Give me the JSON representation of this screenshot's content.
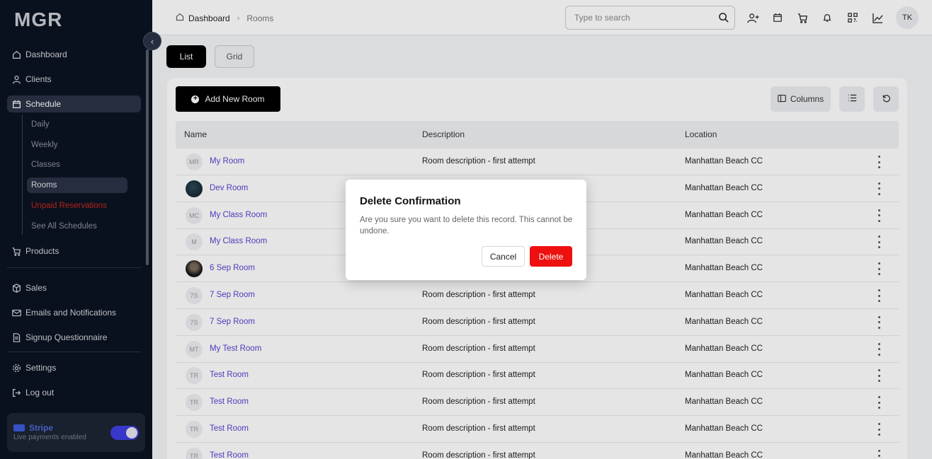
{
  "sidebar": {
    "logo": "MGR",
    "items": [
      {
        "label": "Dashboard",
        "icon": "home-icon"
      },
      {
        "label": "Clients",
        "icon": "user-icon"
      },
      {
        "label": "Schedule",
        "icon": "calendar-icon"
      },
      {
        "label": "Products",
        "icon": "cart-icon"
      },
      {
        "label": "Sales",
        "icon": "box-icon"
      },
      {
        "label": "Emails and Notifications",
        "icon": "mail-icon"
      },
      {
        "label": "Signup Questionnaire",
        "icon": "document-icon"
      },
      {
        "label": "Settings",
        "icon": "gear-icon"
      },
      {
        "label": "Log out",
        "icon": "logout-icon"
      }
    ],
    "schedule_sub": [
      "Daily",
      "Weekly",
      "Classes",
      "Rooms",
      "Unpaid Reservations",
      "See All Schedules"
    ],
    "stripe": {
      "title": "Stripe",
      "subtitle": "Live payments enabled",
      "enabled": true
    }
  },
  "header": {
    "breadcrumb": [
      "Dashboard",
      "Rooms"
    ],
    "search_placeholder": "Type to search",
    "avatar": "TK"
  },
  "main": {
    "tabs": [
      "List",
      "Grid"
    ],
    "add_button": "Add New Room",
    "columns_button": "Columns",
    "table": {
      "headers": [
        "Name",
        "Description",
        "Location"
      ],
      "rows": [
        {
          "initials": "MR",
          "name": "My Room",
          "desc": "Room description - first attempt",
          "loc": "Manhattan Beach CC"
        },
        {
          "initials": "",
          "name": "Dev Room",
          "desc": "",
          "loc": "Manhattan Beach CC"
        },
        {
          "initials": "MC",
          "name": "My Class Room",
          "desc": "",
          "loc": "Manhattan Beach CC"
        },
        {
          "initials": "M",
          "name": "My Class Room",
          "desc": "",
          "loc": "Manhattan Beach CC"
        },
        {
          "initials": "",
          "name": "6 Sep Room",
          "desc": "",
          "loc": "Manhattan Beach CC"
        },
        {
          "initials": "7S",
          "name": "7 Sep Room",
          "desc": "Room description - first attempt",
          "loc": "Manhattan Beach CC"
        },
        {
          "initials": "7S",
          "name": "7 Sep Room",
          "desc": "Room description - first attempt",
          "loc": "Manhattan Beach CC"
        },
        {
          "initials": "MT",
          "name": "My Test Room",
          "desc": "Room description - first attempt",
          "loc": "Manhattan Beach CC"
        },
        {
          "initials": "TR",
          "name": "Test Room",
          "desc": "Room description - first attempt",
          "loc": "Manhattan Beach CC"
        },
        {
          "initials": "TR",
          "name": "Test Room",
          "desc": "Room description - first attempt",
          "loc": "Manhattan Beach CC"
        },
        {
          "initials": "TR",
          "name": "Test Room",
          "desc": "Room description - first attempt",
          "loc": "Manhattan Beach CC"
        },
        {
          "initials": "TR",
          "name": "Test Room",
          "desc": "Room description - first attempt",
          "loc": "Manhattan Beach CC"
        }
      ]
    }
  },
  "modal": {
    "title": "Delete Confirmation",
    "message": "Are you sure you want to delete this record. This cannot be undone.",
    "cancel": "Cancel",
    "delete": "Delete"
  },
  "colors": {
    "accent": "#5b3fd1",
    "danger": "#ee0f0f",
    "sidebar": "#0c1322"
  }
}
